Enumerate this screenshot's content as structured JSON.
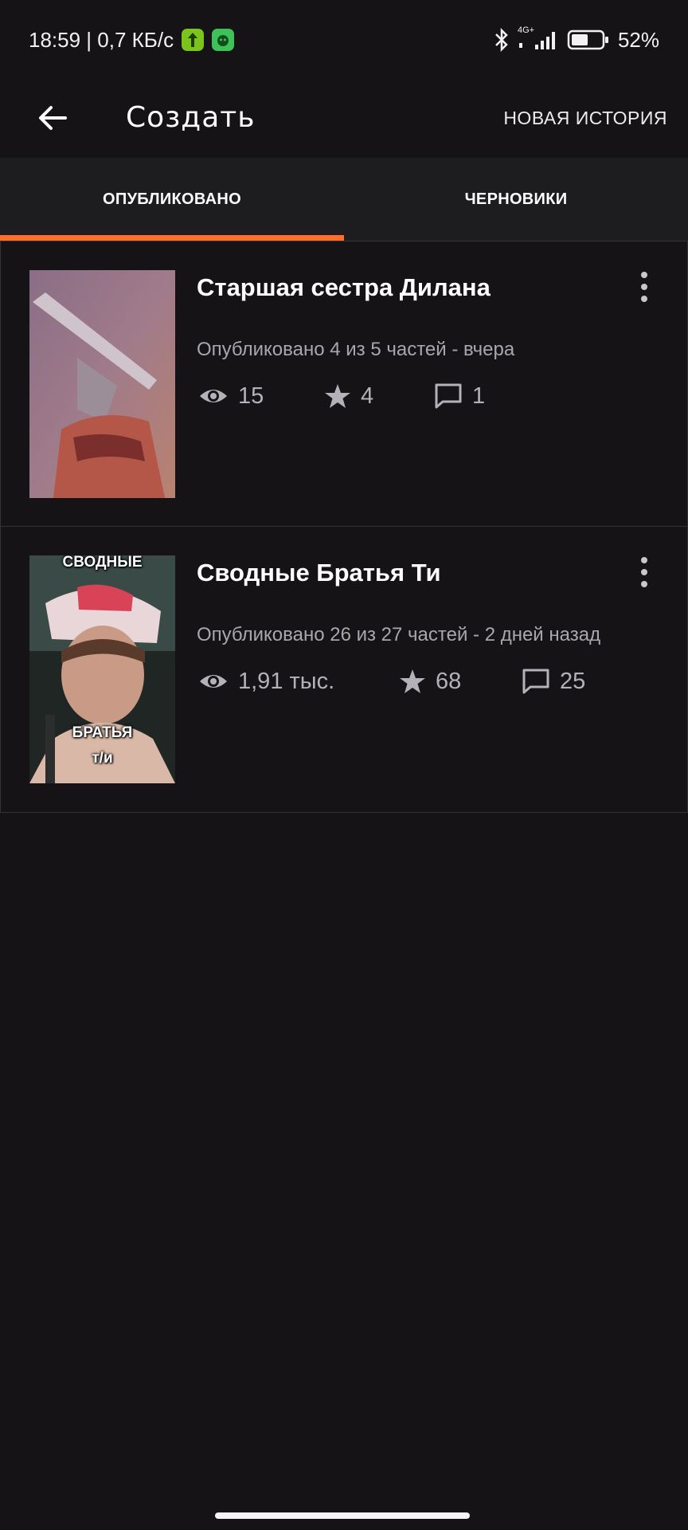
{
  "status_bar": {
    "time_speed": "18:59 | 0,7 КБ/с",
    "network": "4G+",
    "battery": "52%"
  },
  "app_bar": {
    "title": "Создать",
    "new_story_label": "НОВАЯ ИСТОРИЯ",
    "back_icon": "arrow-left-icon"
  },
  "tabs": [
    {
      "label": "ОПУБЛИКОВАНО",
      "selected": true
    },
    {
      "label": "ЧЕРНОВИКИ",
      "selected": false
    }
  ],
  "colors": {
    "accent": "#ff6f2c",
    "background": "#151316",
    "tab_bar": "#1d1c1f",
    "meta_text": "#a9a7ad"
  },
  "stories": [
    {
      "title": "Старшая сестра Дилана",
      "meta": "Опубликовано 4 из 5 частей - вчера",
      "views": "15",
      "votes": "4",
      "comments": "1",
      "cover_text_top": "",
      "cover_text_bottom": "",
      "cover_text_sub": ""
    },
    {
      "title": "Сводные Братья Ти",
      "meta": "Опубликовано 26 из 27 частей - 2 дней назад",
      "views": "1,91 тыс.",
      "votes": "68",
      "comments": "25",
      "cover_text_top": "СВОДНЫЕ",
      "cover_text_bottom": "БРАТЬЯ",
      "cover_text_sub": "т/и"
    }
  ]
}
